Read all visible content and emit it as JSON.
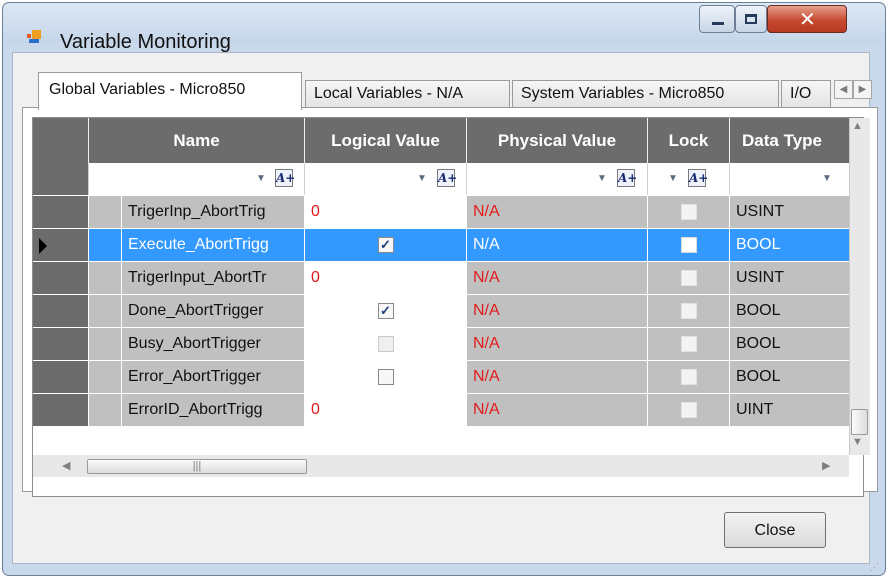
{
  "window": {
    "title": "Variable Monitoring",
    "controls": {
      "minimize": "minimize",
      "maximize": "maximize",
      "close": "close"
    }
  },
  "tabs": [
    {
      "label": "Global Variables - Micro850",
      "active": true
    },
    {
      "label": "Local Variables - N/A",
      "active": false
    },
    {
      "label": "System Variables - Micro850",
      "active": false
    },
    {
      "label": "I/O",
      "active": false
    }
  ],
  "grid": {
    "columns": [
      "Name",
      "Logical Value",
      "Physical Value",
      "Lock",
      "Data Type"
    ],
    "filter_icon": "A+",
    "rows": [
      {
        "name": "TrigerInp_AbortTrig",
        "logical": "0",
        "logical_check": null,
        "physical": "N/A",
        "lock": false,
        "dtype": "USINT",
        "selected": false
      },
      {
        "name": "Execute_AbortTrigg",
        "logical": "",
        "logical_check": "checked",
        "physical": "N/A",
        "lock": false,
        "dtype": "BOOL",
        "selected": true
      },
      {
        "name": "TrigerInput_AbortTr",
        "logical": "0",
        "logical_check": null,
        "physical": "N/A",
        "lock": false,
        "dtype": "USINT",
        "selected": false
      },
      {
        "name": "Done_AbortTrigger",
        "logical": "",
        "logical_check": "checked",
        "physical": "N/A",
        "lock": false,
        "dtype": "BOOL",
        "selected": false
      },
      {
        "name": "Busy_AbortTrigger",
        "logical": "",
        "logical_check": "disabled",
        "physical": "N/A",
        "lock": false,
        "dtype": "BOOL",
        "selected": false
      },
      {
        "name": "Error_AbortTrigger",
        "logical": "",
        "logical_check": "unchecked",
        "physical": "N/A",
        "lock": false,
        "dtype": "BOOL",
        "selected": false
      },
      {
        "name": "ErrorID_AbortTrigg",
        "logical": "0",
        "logical_check": null,
        "physical": "N/A",
        "lock": false,
        "dtype": "UINT",
        "selected": false
      }
    ]
  },
  "footer": {
    "close_label": "Close"
  },
  "colors": {
    "header_bg": "#6c6c6c",
    "selection": "#3399ff",
    "value_red": "#e21a1a",
    "cell_gray": "#c0c0c0"
  }
}
